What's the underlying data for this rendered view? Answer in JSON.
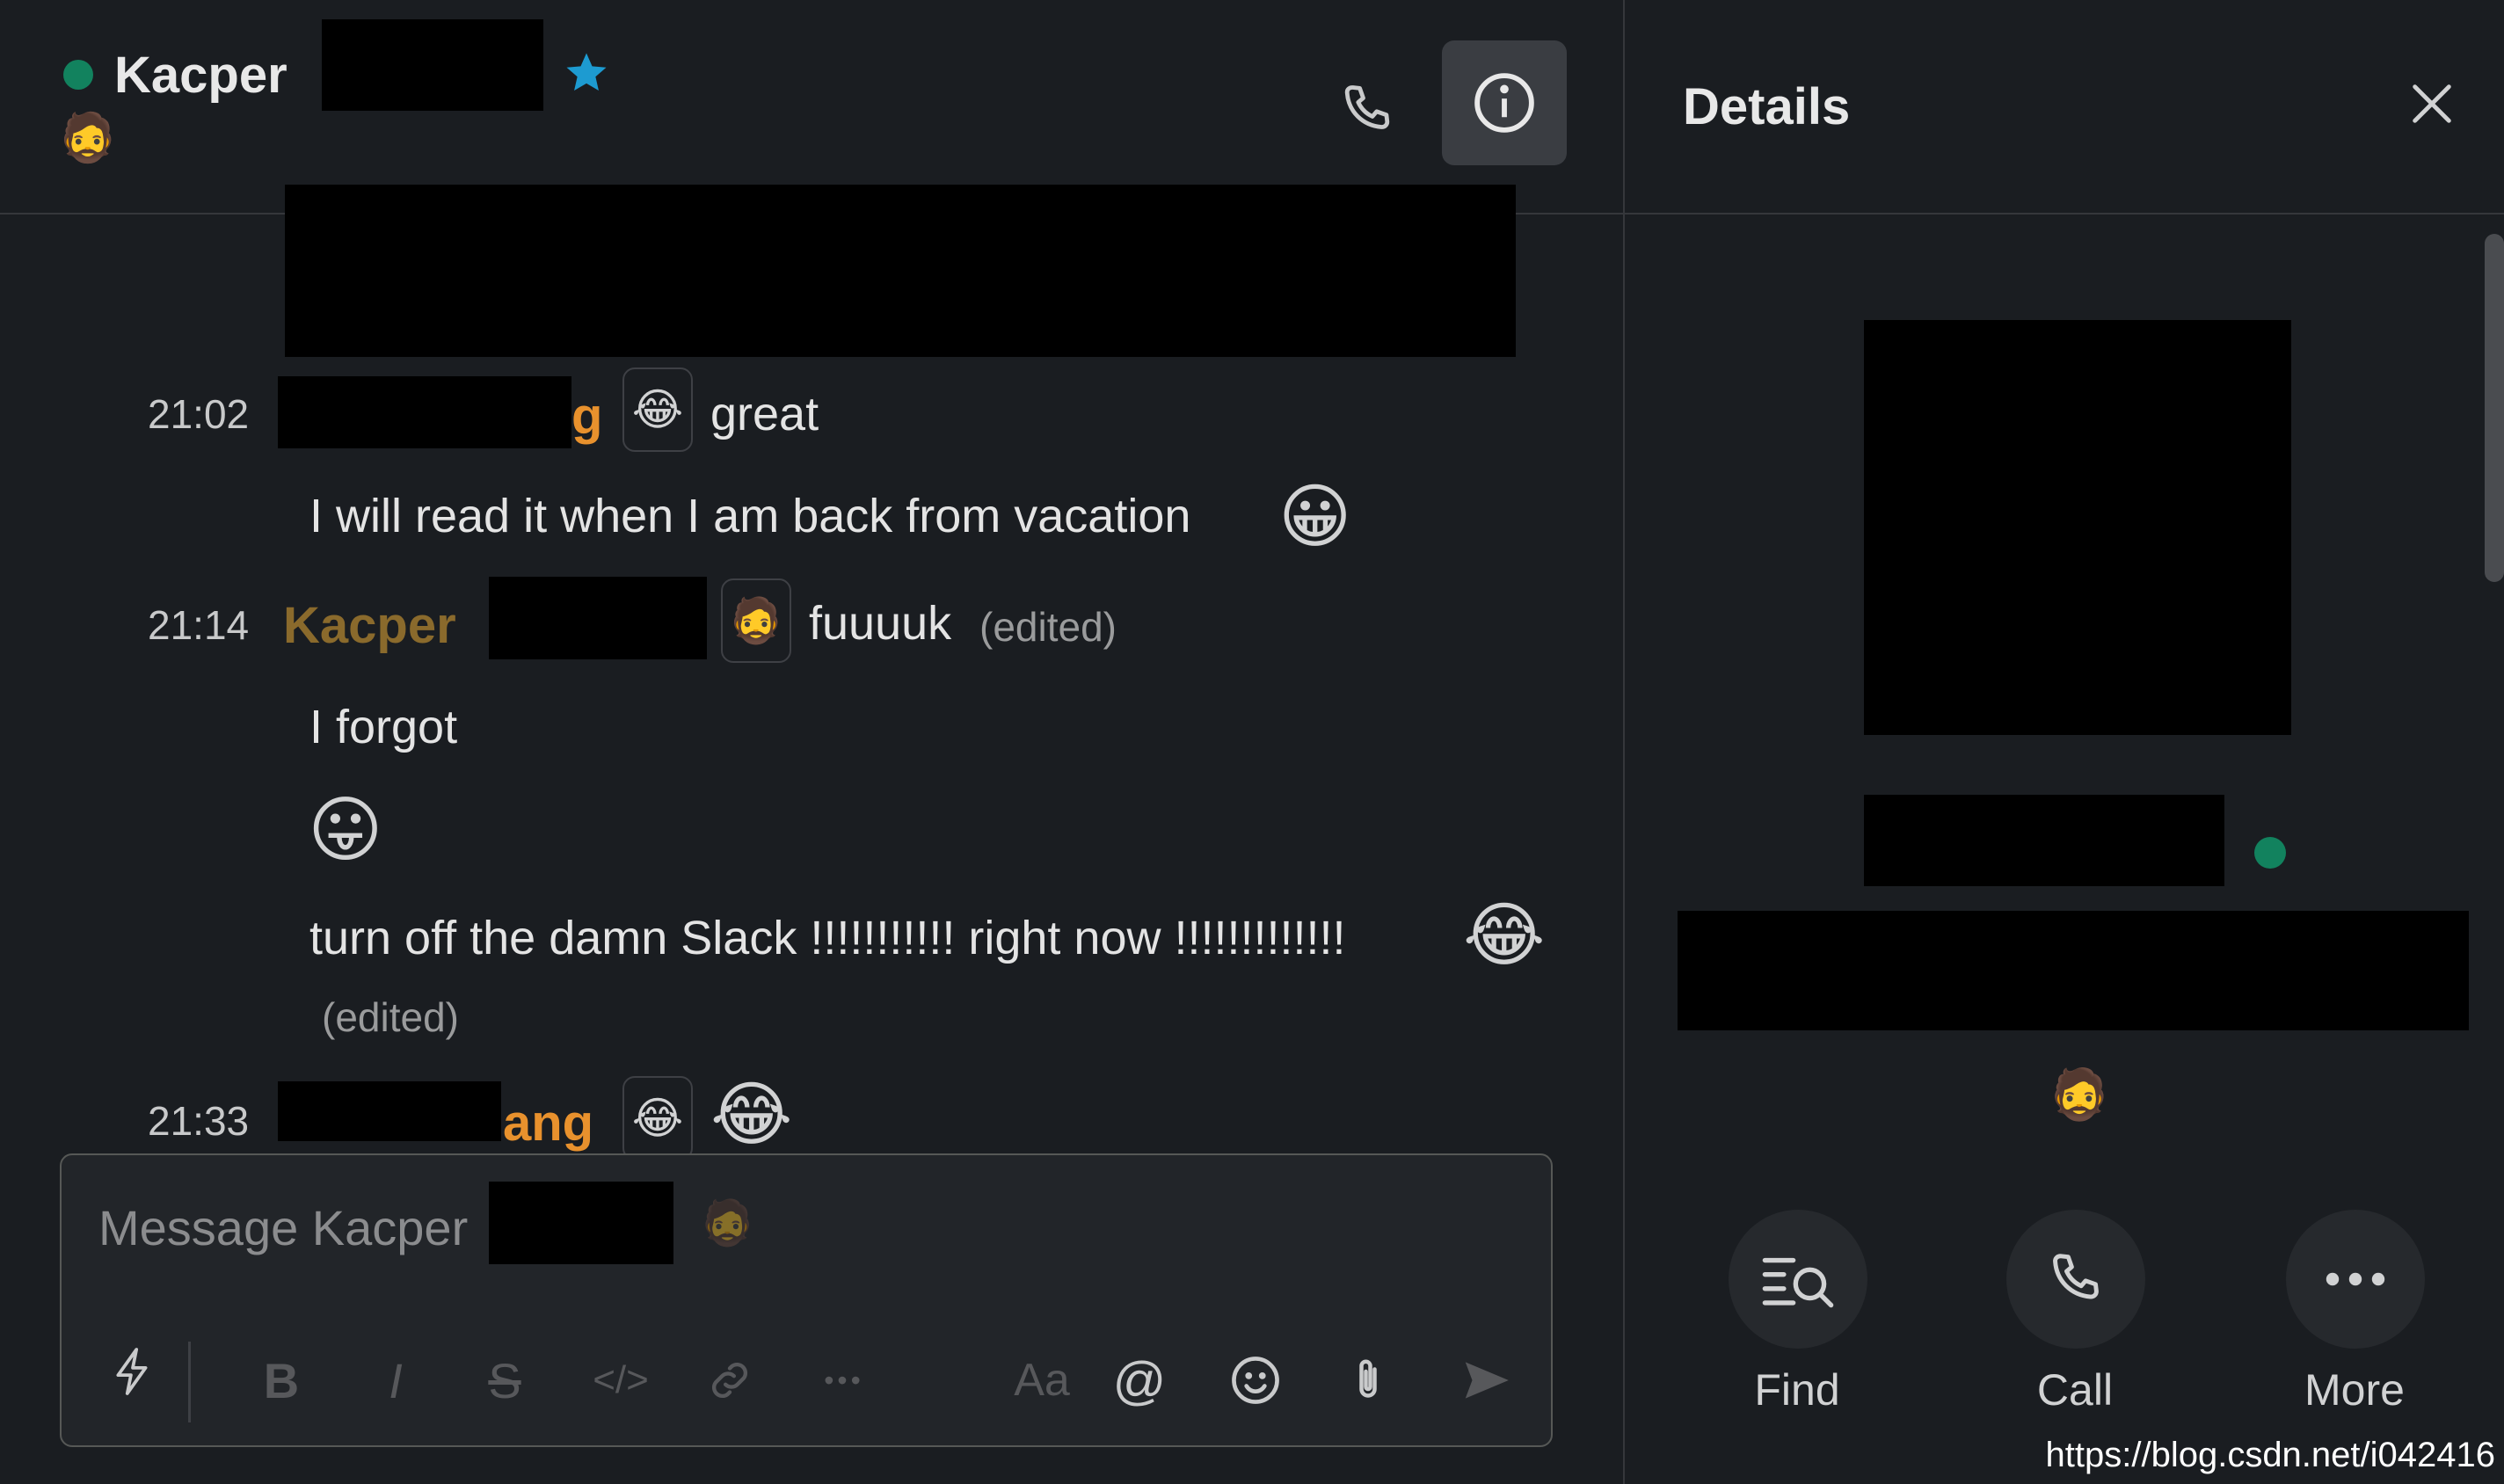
{
  "header": {
    "contact_name": "Kacper",
    "status_emoji": "🧔",
    "star_icon": "star-icon",
    "call_icon": "phone-icon",
    "info_icon": "info-icon"
  },
  "messages": [
    {
      "time": "21:02",
      "sender_visible": "g",
      "sender_color": "#e8912d",
      "status_emoji": "😂",
      "lines": [
        "great",
        "I will read it when I am back from vacation"
      ],
      "line_emoji": "😀"
    },
    {
      "time": "21:14",
      "sender_visible": "Kacper",
      "sender_color": "#8a6a2c",
      "status_emoji": "🧔",
      "first_line": "fuuuuk",
      "first_line_edited": "(edited)",
      "lines": [
        "I forgot",
        "turn off the damn Slack !!!!!!!!!!! right now !!!!!!!!!!!!! "
      ],
      "emoji_line": "😛",
      "last_line_emoji": "😂",
      "last_line_edited": "(edited)"
    },
    {
      "time": "21:33",
      "sender_visible": "ang",
      "sender_color": "#e8912d",
      "status_emoji": "😂",
      "emoji": "😂"
    }
  ],
  "composer": {
    "placeholder": "Message Kacper",
    "placeholder_emoji": "🧔",
    "toolbar": {
      "bold": "B",
      "italic": "I",
      "strike": "S",
      "code": "</>",
      "more": "•••",
      "format": "Aa",
      "mention": "@"
    }
  },
  "details": {
    "title": "Details",
    "status_emoji": "🧔",
    "actions": [
      {
        "label": "Find",
        "icon": "find-icon"
      },
      {
        "label": "Call",
        "icon": "phone-icon"
      },
      {
        "label": "More",
        "icon": "more-icon"
      }
    ]
  },
  "watermark": "https://blog.csdn.net/i042416",
  "colors": {
    "background": "#1a1d21",
    "presence": "#12825e",
    "star": "#1d9bd1",
    "sender_orange": "#e8912d"
  }
}
